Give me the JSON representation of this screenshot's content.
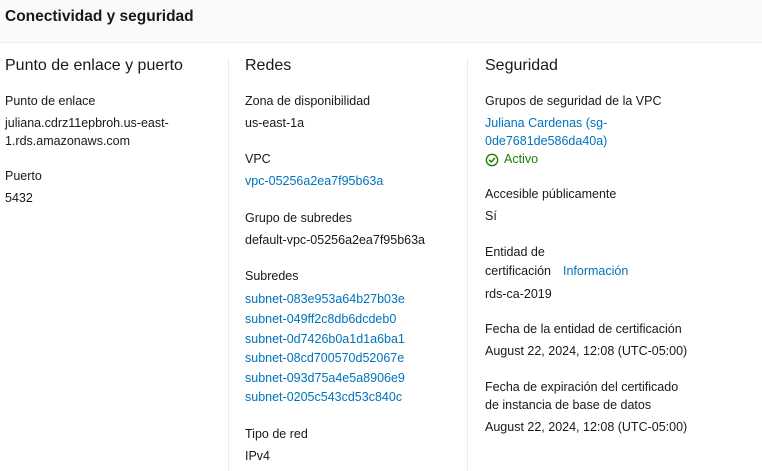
{
  "header": {
    "title": "Conectividad y seguridad"
  },
  "endpoint_col": {
    "title": "Punto de enlace y puerto",
    "endpoint_label": "Punto de enlace",
    "endpoint_line1": "juliana.cdrz11epbroh.us-east-",
    "endpoint_line2": "1.rds.amazonaws.com",
    "port_label": "Puerto",
    "port_value": "5432"
  },
  "network_col": {
    "title": "Redes",
    "az_label": "Zona de disponibilidad",
    "az_value": "us-east-1a",
    "vpc_label": "VPC",
    "vpc_value": "vpc-05256a2ea7f95b63a",
    "subnet_group_label": "Grupo de subredes",
    "subnet_group_value": "default-vpc-05256a2ea7f95b63a",
    "subnets_label": "Subredes",
    "subnets": [
      "subnet-083e953a64b27b03e",
      "subnet-049ff2c8db6dcdeb0",
      "subnet-0d7426b0a1d1a6ba1",
      "subnet-08cd700570d52067e",
      "subnet-093d75a4e5a8906e9",
      "subnet-0205c543cd53c840c"
    ],
    "network_type_label": "Tipo de red",
    "network_type_value": "IPv4"
  },
  "security_col": {
    "title": "Seguridad",
    "sg_label": "Grupos de seguridad de la VPC",
    "sg_link_line1": "Juliana Cardenas (sg-",
    "sg_link_line2": "0de7681de586da40a)",
    "sg_status": "Activo",
    "public_label": "Accesible públicamente",
    "public_value": "Sí",
    "ca_label_line1": "Entidad de",
    "ca_label_line2": "certificación",
    "ca_info_link": "Información",
    "ca_value": "rds-ca-2019",
    "ca_date_label": "Fecha de la entidad de certificación",
    "ca_date_value": "August 22, 2024, 12:08 (UTC-05:00)",
    "cert_exp_label_line1": "Fecha de expiración del certificado",
    "cert_exp_label_line2": "de instancia de base de datos",
    "cert_exp_value": "August 22, 2024, 12:08 (UTC-05:00)"
  },
  "colors": {
    "link": "#0073bb",
    "status_success": "#1d8102",
    "text": "#16191f",
    "divider": "#eaeded"
  }
}
